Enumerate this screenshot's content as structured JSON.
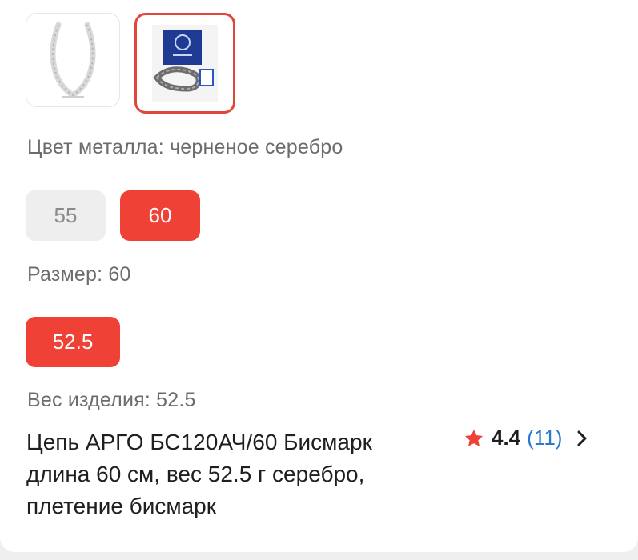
{
  "gallery": {
    "thumbnails": [
      {
        "icon": "silver-chain-photo",
        "selected": false
      },
      {
        "icon": "chain-with-certificate-photo",
        "selected": true
      }
    ]
  },
  "metal_color": {
    "label": "Цвет металла: черненое серебро"
  },
  "length_options": {
    "items": [
      {
        "label": "55",
        "selected": false
      },
      {
        "label": "60",
        "selected": true
      }
    ]
  },
  "size": {
    "label": "Размер: 60"
  },
  "weight_options": {
    "items": [
      {
        "label": "52.5",
        "selected": true
      }
    ]
  },
  "weight": {
    "label": "Вес изделия: 52.5"
  },
  "product": {
    "title_line1": "Цепь АРГО БС120АЧ/60 Бисмарк",
    "title_line2": "длина 60 см, вес 52.5 г серебро,",
    "title_line3": "плетение бисмарк",
    "rating": "4.4",
    "reviews": "(11)"
  },
  "colors": {
    "accent": "#ef4135",
    "selected_border": "#e0463a",
    "link": "#2c78d0",
    "muted_chip": "#eeeeee"
  }
}
